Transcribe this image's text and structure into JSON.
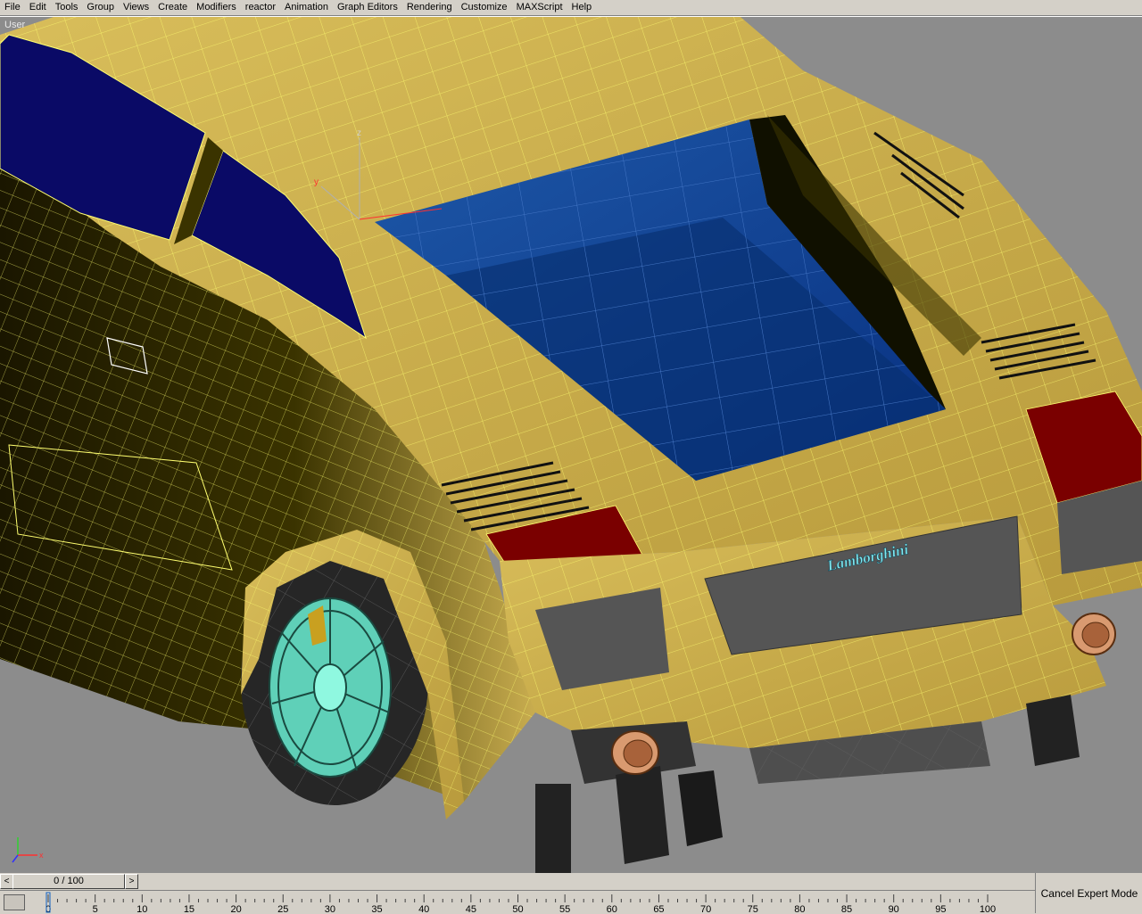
{
  "menu": [
    "File",
    "Edit",
    "Tools",
    "Group",
    "Views",
    "Create",
    "Modifiers",
    "reactor",
    "Animation",
    "Graph Editors",
    "Rendering",
    "Customize",
    "MAXScript",
    "Help"
  ],
  "viewport": {
    "label": "User",
    "badge": "Lamborghini",
    "gizmo_labels": {
      "z": "z",
      "y": "y",
      "x": "x"
    },
    "colors": {
      "body": "#c9ad4f",
      "body_dark": "#2a2400",
      "wire": "#ffff66",
      "glass": "#0a0a66",
      "rear_glass": "#0a3a8a",
      "taillight": "#7a0000",
      "wheel": "#7ff0d8",
      "background": "#8c8c8c"
    }
  },
  "timeline": {
    "frame_display": "0 / 100",
    "current": 0,
    "total": 100,
    "prev_label": "<",
    "next_label": ">",
    "ticks": [
      "0",
      "5",
      "10",
      "15",
      "20",
      "25",
      "30",
      "35",
      "40",
      "45",
      "50",
      "55",
      "60",
      "65",
      "70",
      "75",
      "80",
      "85",
      "90",
      "95",
      "100"
    ]
  },
  "status": {
    "cancel_expert": "Cancel Expert Mode"
  }
}
